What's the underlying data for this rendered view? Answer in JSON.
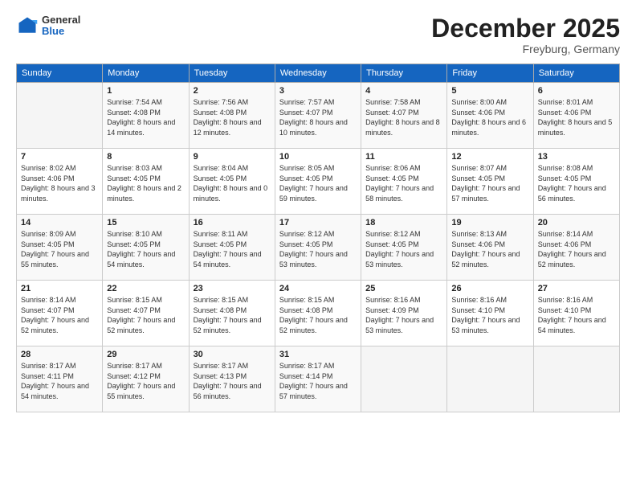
{
  "header": {
    "logo": {
      "general": "General",
      "blue": "Blue"
    },
    "title": "December 2025",
    "location": "Freyburg, Germany"
  },
  "days_of_week": [
    "Sunday",
    "Monday",
    "Tuesday",
    "Wednesday",
    "Thursday",
    "Friday",
    "Saturday"
  ],
  "weeks": [
    [
      {
        "day": "",
        "sunrise": "",
        "sunset": "",
        "daylight": ""
      },
      {
        "day": "1",
        "sunrise": "7:54 AM",
        "sunset": "4:08 PM",
        "daylight": "8 hours and 14 minutes."
      },
      {
        "day": "2",
        "sunrise": "7:56 AM",
        "sunset": "4:08 PM",
        "daylight": "8 hours and 12 minutes."
      },
      {
        "day": "3",
        "sunrise": "7:57 AM",
        "sunset": "4:07 PM",
        "daylight": "8 hours and 10 minutes."
      },
      {
        "day": "4",
        "sunrise": "7:58 AM",
        "sunset": "4:07 PM",
        "daylight": "8 hours and 8 minutes."
      },
      {
        "day": "5",
        "sunrise": "8:00 AM",
        "sunset": "4:06 PM",
        "daylight": "8 hours and 6 minutes."
      },
      {
        "day": "6",
        "sunrise": "8:01 AM",
        "sunset": "4:06 PM",
        "daylight": "8 hours and 5 minutes."
      }
    ],
    [
      {
        "day": "7",
        "sunrise": "8:02 AM",
        "sunset": "4:06 PM",
        "daylight": "8 hours and 3 minutes."
      },
      {
        "day": "8",
        "sunrise": "8:03 AM",
        "sunset": "4:05 PM",
        "daylight": "8 hours and 2 minutes."
      },
      {
        "day": "9",
        "sunrise": "8:04 AM",
        "sunset": "4:05 PM",
        "daylight": "8 hours and 0 minutes."
      },
      {
        "day": "10",
        "sunrise": "8:05 AM",
        "sunset": "4:05 PM",
        "daylight": "7 hours and 59 minutes."
      },
      {
        "day": "11",
        "sunrise": "8:06 AM",
        "sunset": "4:05 PM",
        "daylight": "7 hours and 58 minutes."
      },
      {
        "day": "12",
        "sunrise": "8:07 AM",
        "sunset": "4:05 PM",
        "daylight": "7 hours and 57 minutes."
      },
      {
        "day": "13",
        "sunrise": "8:08 AM",
        "sunset": "4:05 PM",
        "daylight": "7 hours and 56 minutes."
      }
    ],
    [
      {
        "day": "14",
        "sunrise": "8:09 AM",
        "sunset": "4:05 PM",
        "daylight": "7 hours and 55 minutes."
      },
      {
        "day": "15",
        "sunrise": "8:10 AM",
        "sunset": "4:05 PM",
        "daylight": "7 hours and 54 minutes."
      },
      {
        "day": "16",
        "sunrise": "8:11 AM",
        "sunset": "4:05 PM",
        "daylight": "7 hours and 54 minutes."
      },
      {
        "day": "17",
        "sunrise": "8:12 AM",
        "sunset": "4:05 PM",
        "daylight": "7 hours and 53 minutes."
      },
      {
        "day": "18",
        "sunrise": "8:12 AM",
        "sunset": "4:05 PM",
        "daylight": "7 hours and 53 minutes."
      },
      {
        "day": "19",
        "sunrise": "8:13 AM",
        "sunset": "4:06 PM",
        "daylight": "7 hours and 52 minutes."
      },
      {
        "day": "20",
        "sunrise": "8:14 AM",
        "sunset": "4:06 PM",
        "daylight": "7 hours and 52 minutes."
      }
    ],
    [
      {
        "day": "21",
        "sunrise": "8:14 AM",
        "sunset": "4:07 PM",
        "daylight": "7 hours and 52 minutes."
      },
      {
        "day": "22",
        "sunrise": "8:15 AM",
        "sunset": "4:07 PM",
        "daylight": "7 hours and 52 minutes."
      },
      {
        "day": "23",
        "sunrise": "8:15 AM",
        "sunset": "4:08 PM",
        "daylight": "7 hours and 52 minutes."
      },
      {
        "day": "24",
        "sunrise": "8:15 AM",
        "sunset": "4:08 PM",
        "daylight": "7 hours and 52 minutes."
      },
      {
        "day": "25",
        "sunrise": "8:16 AM",
        "sunset": "4:09 PM",
        "daylight": "7 hours and 53 minutes."
      },
      {
        "day": "26",
        "sunrise": "8:16 AM",
        "sunset": "4:10 PM",
        "daylight": "7 hours and 53 minutes."
      },
      {
        "day": "27",
        "sunrise": "8:16 AM",
        "sunset": "4:10 PM",
        "daylight": "7 hours and 54 minutes."
      }
    ],
    [
      {
        "day": "28",
        "sunrise": "8:17 AM",
        "sunset": "4:11 PM",
        "daylight": "7 hours and 54 minutes."
      },
      {
        "day": "29",
        "sunrise": "8:17 AM",
        "sunset": "4:12 PM",
        "daylight": "7 hours and 55 minutes."
      },
      {
        "day": "30",
        "sunrise": "8:17 AM",
        "sunset": "4:13 PM",
        "daylight": "7 hours and 56 minutes."
      },
      {
        "day": "31",
        "sunrise": "8:17 AM",
        "sunset": "4:14 PM",
        "daylight": "7 hours and 57 minutes."
      },
      {
        "day": "",
        "sunrise": "",
        "sunset": "",
        "daylight": ""
      },
      {
        "day": "",
        "sunrise": "",
        "sunset": "",
        "daylight": ""
      },
      {
        "day": "",
        "sunrise": "",
        "sunset": "",
        "daylight": ""
      }
    ]
  ]
}
